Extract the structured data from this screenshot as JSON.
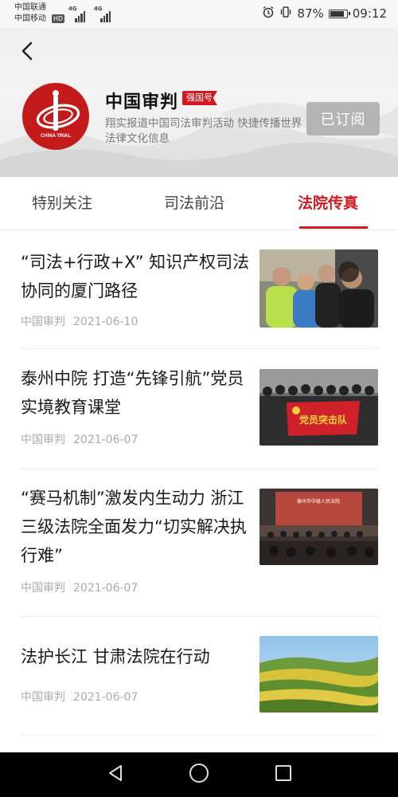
{
  "status_bar": {
    "carrier_1": "中国联通",
    "carrier_2": "中国移动",
    "hd": "HD",
    "net_1": "4G",
    "net_2": "4G",
    "battery": "87%",
    "time": "09:12",
    "icons": [
      "alarm-icon",
      "vibrate-icon",
      "battery-icon"
    ]
  },
  "header": {
    "back_icon": "chevron-left-icon",
    "account_name": "中国审判",
    "badge": "强国号",
    "description": "翔实报道中国司法审判活动 快捷传播世界法律文化信息",
    "subscribe_label": "已订阅",
    "logo_text": "CHINA TRIAL",
    "accent": "#d2191f"
  },
  "tabs": [
    {
      "label": "特别关注",
      "active": false
    },
    {
      "label": "司法前沿",
      "active": false
    },
    {
      "label": "法院传真",
      "active": true
    }
  ],
  "articles": [
    {
      "title": "“司法+行政+X” 知识产权司法协同的厦门路径",
      "source": "中国审判",
      "date": "2021-06-10"
    },
    {
      "title": "泰州中院 打造“先锋引航”党员实境教育课堂",
      "source": "中国审判",
      "date": "2021-06-07"
    },
    {
      "title": "“赛马机制”激发内生动力 浙江三级法院全面发力“切实解决执行难”",
      "source": "中国审判",
      "date": "2021-06-07"
    },
    {
      "title": "法护长江 甘肃法院在行动",
      "source": "中国审判",
      "date": "2021-06-07"
    }
  ],
  "thumbnails": {
    "article_2_banner": "党员突击队",
    "article_3_screen": "泰州市中级人民法院"
  },
  "nav_bar": {
    "icons": [
      "back-triangle-icon",
      "home-circle-icon",
      "recent-square-icon"
    ]
  }
}
